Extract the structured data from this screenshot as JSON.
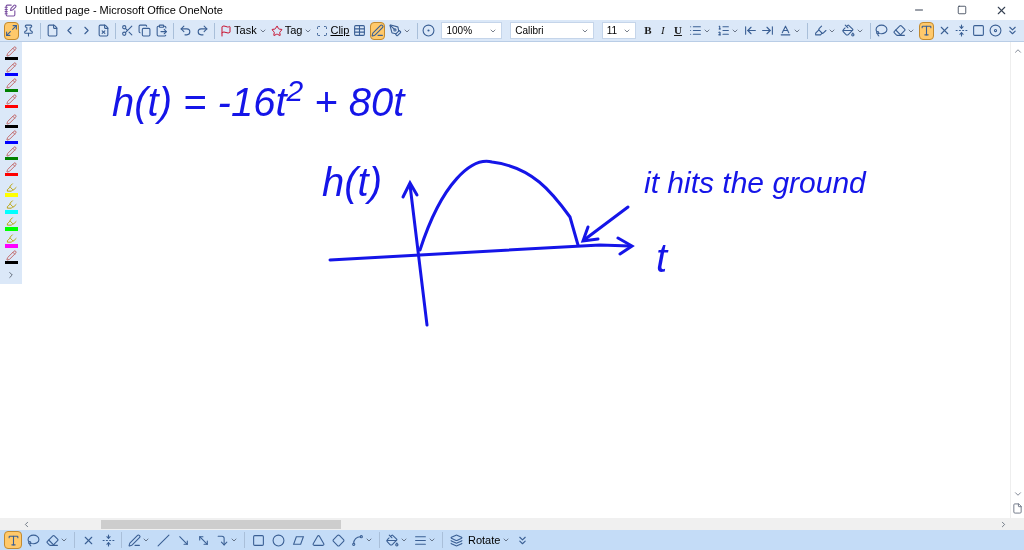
{
  "window": {
    "title": "Untitled page - Microsoft Office OneNote"
  },
  "toolbar": [
    {
      "kind": "icon",
      "selected": true
    },
    {
      "kind": "icon",
      "selected": false
    },
    {
      "kind": "separator"
    },
    {
      "kind": "icon",
      "selected": false
    },
    {
      "kind": "icon",
      "selected": false
    },
    {
      "kind": "icon",
      "selected": false
    },
    {
      "kind": "icon",
      "selected": false
    },
    {
      "kind": "separator"
    },
    {
      "kind": "icon",
      "selected": false
    },
    {
      "kind": "icon",
      "selected": false
    },
    {
      "kind": "icon",
      "selected": false
    },
    {
      "kind": "separator"
    },
    {
      "kind": "icon",
      "selected": false
    },
    {
      "kind": "icon",
      "selected": false
    },
    {
      "kind": "separator"
    },
    {
      "kind": "menu",
      "label": "Task"
    },
    {
      "kind": "menu",
      "label": "Tag"
    },
    {
      "kind": "label_button",
      "label": "Clip"
    },
    {
      "kind": "icon",
      "selected": false
    },
    {
      "kind": "icon",
      "selected": true
    },
    {
      "kind": "dropdown",
      "selected": false
    },
    {
      "kind": "separator"
    },
    {
      "kind": "icon",
      "selected": false
    },
    {
      "kind": "combo",
      "value": "100%"
    },
    {
      "kind": "combo",
      "value": "Calibri"
    },
    {
      "kind": "combo",
      "value": "11"
    },
    {
      "kind": "format",
      "label": "B"
    },
    {
      "kind": "format",
      "label": "I"
    },
    {
      "kind": "format",
      "label": "U"
    },
    {
      "kind": "dropdown",
      "selected": false
    },
    {
      "kind": "dropdown",
      "selected": false
    },
    {
      "kind": "icon",
      "selected": false
    },
    {
      "kind": "icon",
      "selected": false
    },
    {
      "kind": "dropdown",
      "selected": false
    },
    {
      "kind": "separator"
    },
    {
      "kind": "dropdown",
      "selected": false
    },
    {
      "kind": "dropdown",
      "selected": false
    },
    {
      "kind": "separator"
    },
    {
      "kind": "icon",
      "selected": false
    },
    {
      "kind": "dropdown",
      "selected": false
    },
    {
      "kind": "icon",
      "selected": true
    },
    {
      "kind": "icon",
      "selected": false
    },
    {
      "kind": "icon",
      "selected": false
    },
    {
      "kind": "icon",
      "selected": false
    },
    {
      "kind": "icon",
      "selected": false
    },
    {
      "kind": "icon",
      "selected": false
    }
  ],
  "pen_palette": [
    {
      "kind": "pen",
      "color": "#000000"
    },
    {
      "kind": "pen",
      "color": "#0000ff"
    },
    {
      "kind": "pen",
      "color": "#008000"
    },
    {
      "kind": "pen",
      "color": "#ff0000"
    },
    {
      "kind": "pen",
      "color": "#000000"
    },
    {
      "kind": "pen",
      "color": "#0000ff"
    },
    {
      "kind": "pen",
      "color": "#008000"
    },
    {
      "kind": "pen",
      "color": "#ff0000"
    },
    {
      "kind": "highlighter",
      "color": "#ffff00"
    },
    {
      "kind": "highlighter",
      "color": "#00ffff"
    },
    {
      "kind": "highlighter",
      "color": "#00ff00"
    },
    {
      "kind": "highlighter",
      "color": "#ff00ff"
    },
    {
      "kind": "pen",
      "color": "#000000"
    }
  ],
  "page": {
    "ink_texts": [
      {
        "text": "h(t) = -16t$^{2}$ + 80t"
      },
      {
        "text": "h(t)"
      },
      {
        "text": "it hits the ground"
      },
      {
        "text": "t"
      }
    ]
  },
  "drawing_toolbar": [
    {
      "kind": "icon",
      "selected": true
    },
    {
      "kind": "icon",
      "selected": false
    },
    {
      "kind": "dropdown",
      "selected": false
    },
    {
      "kind": "separator"
    },
    {
      "kind": "icon",
      "selected": false
    },
    {
      "kind": "icon",
      "selected": false
    },
    {
      "kind": "separator"
    },
    {
      "kind": "dropdown",
      "selected": false
    },
    {
      "kind": "icon",
      "selected": false
    },
    {
      "kind": "icon",
      "selected": false
    },
    {
      "kind": "icon",
      "selected": false
    },
    {
      "kind": "dropdown",
      "selected": false
    },
    {
      "kind": "separator"
    },
    {
      "kind": "icon",
      "selected": false
    },
    {
      "kind": "icon",
      "selected": false
    },
    {
      "kind": "icon",
      "selected": false
    },
    {
      "kind": "icon",
      "selected": false
    },
    {
      "kind": "icon",
      "selected": false
    },
    {
      "kind": "dropdown",
      "selected": false
    },
    {
      "kind": "separator"
    },
    {
      "kind": "dropdown",
      "selected": false
    },
    {
      "kind": "dropdown",
      "selected": false
    },
    {
      "kind": "separator"
    },
    {
      "kind": "icon",
      "selected": false
    },
    {
      "kind": "text_menu",
      "label": "Rotate"
    },
    {
      "kind": "icon",
      "selected": false
    }
  ]
}
